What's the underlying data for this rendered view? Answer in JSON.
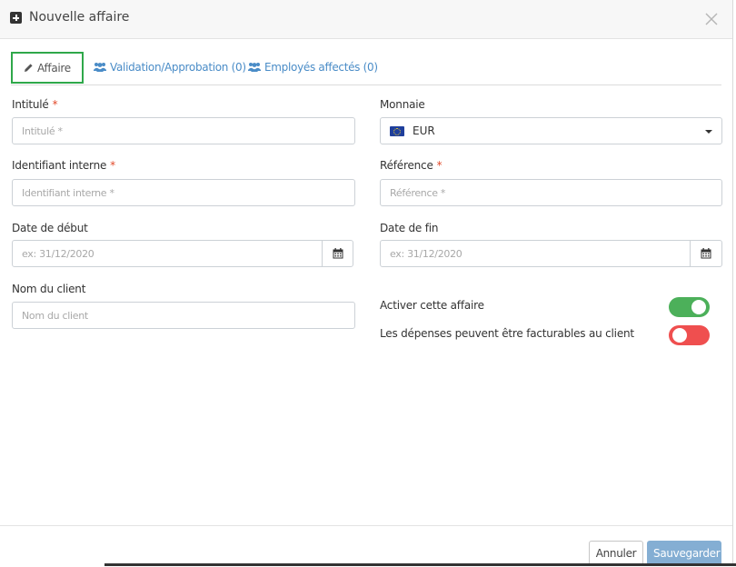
{
  "modal": {
    "title": "Nouvelle affaire"
  },
  "tabs": [
    {
      "label": "Affaire"
    },
    {
      "label": "Validation/Approbation (0)"
    },
    {
      "label": "Employés affectés (0)"
    }
  ],
  "form": {
    "intitule": {
      "label": "Intitulé",
      "required": "*",
      "placeholder": "Intitulé *"
    },
    "identifiant": {
      "label": "Identifiant interne",
      "required": "*",
      "placeholder": "Identifiant interne *"
    },
    "date_debut": {
      "label": "Date de début",
      "placeholder": "ex: 31/12/2020"
    },
    "nom_client": {
      "label": "Nom du client",
      "placeholder": "Nom du client"
    },
    "monnaie": {
      "label": "Monnaie",
      "value": "EUR"
    },
    "reference": {
      "label": "Référence",
      "required": "*",
      "placeholder": "Référence *"
    },
    "date_fin": {
      "label": "Date de fin",
      "placeholder": "ex: 31/12/2020"
    },
    "activer": {
      "label": "Activer cette affaire",
      "state": "on"
    },
    "facturables": {
      "label": "Les dépenses peuvent être facturables au client",
      "state": "off"
    }
  },
  "footer": {
    "cancel_label": "Annuler",
    "save_label": "Sauvegarder"
  },
  "colors": {
    "tab_active_border": "#2fa84a",
    "link": "#4a8cc7",
    "required": "#e24a2b",
    "toggle_on": "#4cb05a",
    "toggle_off": "#ef4f4f",
    "save_button": "#84aed3"
  },
  "icons": {
    "header": "plus-square-icon",
    "close": "close-icon",
    "tab_affaire": "pencil-icon",
    "tab_users": "users-icon",
    "calendar": "calendar-icon",
    "currency_flag": "eu-flag-icon"
  }
}
